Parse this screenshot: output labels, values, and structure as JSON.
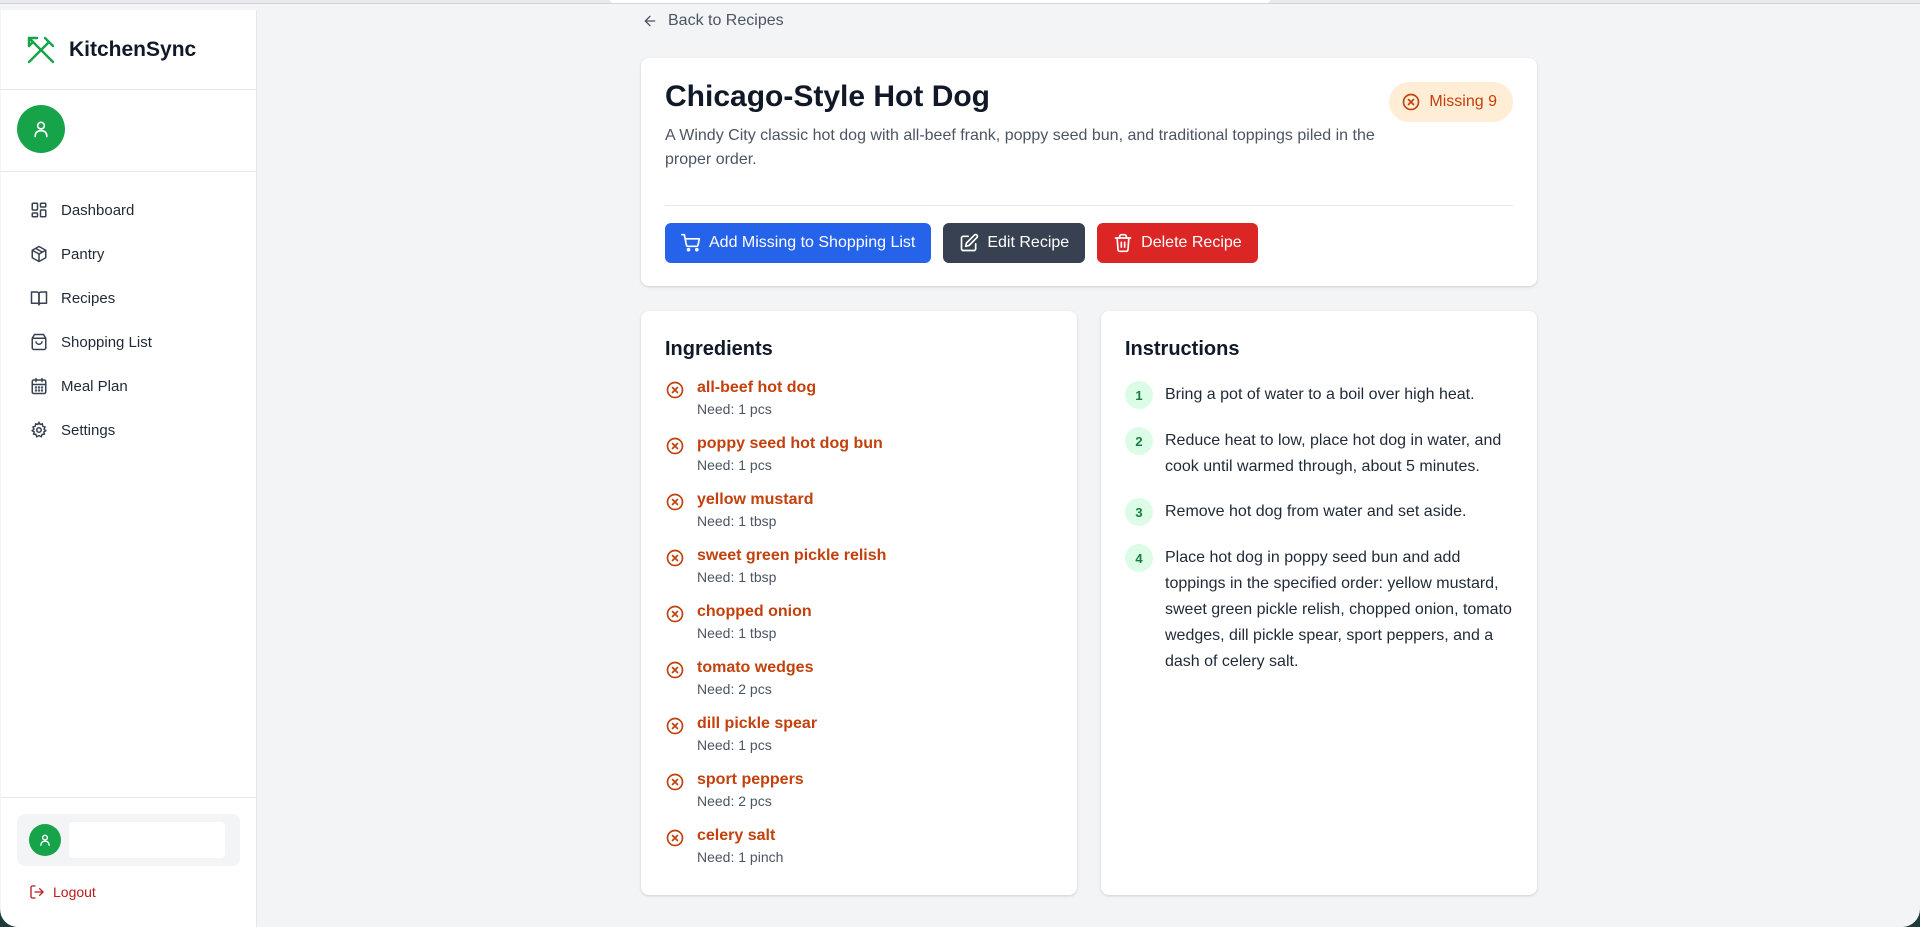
{
  "app": {
    "name": "KitchenSync",
    "colors": {
      "brand": "#16a34a",
      "accent": "#2563eb",
      "danger": "#dc2626",
      "warning": "#c2410c"
    }
  },
  "sidebar": {
    "items": [
      {
        "label": "Dashboard",
        "icon": "grid-icon"
      },
      {
        "label": "Pantry",
        "icon": "box-icon"
      },
      {
        "label": "Recipes",
        "icon": "book-icon"
      },
      {
        "label": "Shopping List",
        "icon": "shopping-bag-icon"
      },
      {
        "label": "Meal Plan",
        "icon": "calendar-icon"
      },
      {
        "label": "Settings",
        "icon": "gear-icon"
      }
    ],
    "logout_label": "Logout"
  },
  "page": {
    "back_label": "Back to Recipes",
    "title": "Chicago-Style Hot Dog",
    "description": "A Windy City classic hot dog with all-beef frank, poppy seed bun, and traditional toppings piled in the proper order.",
    "missing_badge": "Missing 9",
    "actions": {
      "add_missing": "Add Missing to Shopping List",
      "edit": "Edit Recipe",
      "delete": "Delete Recipe"
    }
  },
  "ingredients": {
    "title": "Ingredients",
    "items": [
      {
        "name": "all-beef hot dog",
        "need": "Need: 1 pcs"
      },
      {
        "name": "poppy seed hot dog bun",
        "need": "Need: 1 pcs"
      },
      {
        "name": "yellow mustard",
        "need": "Need: 1 tbsp"
      },
      {
        "name": "sweet green pickle relish",
        "need": "Need: 1 tbsp"
      },
      {
        "name": "chopped onion",
        "need": "Need: 1 tbsp"
      },
      {
        "name": "tomato wedges",
        "need": "Need: 2 pcs"
      },
      {
        "name": "dill pickle spear",
        "need": "Need: 1 pcs"
      },
      {
        "name": "sport peppers",
        "need": "Need: 2 pcs"
      },
      {
        "name": "celery salt",
        "need": "Need: 1 pinch"
      }
    ]
  },
  "instructions": {
    "title": "Instructions",
    "steps": [
      {
        "num": "1",
        "text": "Bring a pot of water to a boil over high heat."
      },
      {
        "num": "2",
        "text": "Reduce heat to low, place hot dog in water, and cook until warmed through, about 5 minutes."
      },
      {
        "num": "3",
        "text": "Remove hot dog from water and set aside."
      },
      {
        "num": "4",
        "text": "Place hot dog in poppy seed bun and add toppings in the specified order: yellow mustard, sweet green pickle relish, chopped onion, tomato wedges, dill pickle spear, sport peppers, and a dash of celery salt."
      }
    ]
  }
}
